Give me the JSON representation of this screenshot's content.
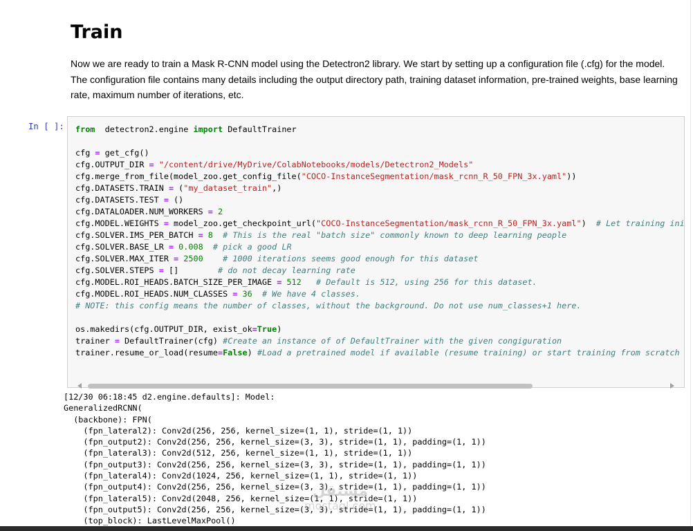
{
  "markdown": {
    "title": "Train",
    "paragraph": "Now we are ready to train a Mask R-CNN model using the Detectron2 library. We start by setting up a configuration file (.cfg) for the model. The configuration file contains many details including the output directory path, training dataset information, pre-trained weights, base learning rate, maximum number of iterations, etc."
  },
  "code_cell": {
    "prompt": "In [ ]:",
    "lines": [
      [
        [
          "kw",
          "from"
        ],
        [
          "",
          "  detectron2.engine "
        ],
        [
          "kw",
          "import"
        ],
        [
          "",
          " DefaultTrainer"
        ]
      ],
      [],
      [
        [
          "",
          "cfg "
        ],
        [
          "op",
          "="
        ],
        [
          "",
          " get_cfg()"
        ]
      ],
      [
        [
          "",
          "cfg.OUTPUT_DIR "
        ],
        [
          "op",
          "="
        ],
        [
          "",
          " "
        ],
        [
          "str",
          "\"/content/drive/MyDrive/ColabNotebooks/models/Detectron2_Models\""
        ]
      ],
      [
        [
          "",
          "cfg.merge_from_file(model_zoo.get_config_file("
        ],
        [
          "str",
          "\"COCO-InstanceSegmentation/mask_rcnn_R_50_FPN_3x.yaml\""
        ],
        [
          "",
          "))"
        ]
      ],
      [
        [
          "",
          "cfg.DATASETS.TRAIN "
        ],
        [
          "op",
          "="
        ],
        [
          "",
          " ("
        ],
        [
          "str",
          "\"my_dataset_train\""
        ],
        [
          "",
          ",)"
        ]
      ],
      [
        [
          "",
          "cfg.DATASETS.TEST "
        ],
        [
          "op",
          "="
        ],
        [
          "",
          " ()"
        ]
      ],
      [
        [
          "",
          "cfg.DATALOADER.NUM_WORKERS "
        ],
        [
          "op",
          "="
        ],
        [
          "",
          " "
        ],
        [
          "num",
          "2"
        ]
      ],
      [
        [
          "",
          "cfg.MODEL.WEIGHTS "
        ],
        [
          "op",
          "="
        ],
        [
          "",
          " model_zoo.get_checkpoint_url("
        ],
        [
          "str",
          "\"COCO-InstanceSegmentation/mask_rcnn_R_50_FPN_3x.yaml\""
        ],
        [
          "",
          ")  "
        ],
        [
          "cm",
          "# Let training initialize from model zoo"
        ]
      ],
      [
        [
          "",
          "cfg.SOLVER.IMS_PER_BATCH "
        ],
        [
          "op",
          "="
        ],
        [
          "",
          " "
        ],
        [
          "num",
          "8"
        ],
        [
          "",
          "  "
        ],
        [
          "cm",
          "# This is the real \"batch size\" commonly known to deep learning people"
        ]
      ],
      [
        [
          "",
          "cfg.SOLVER.BASE_LR "
        ],
        [
          "op",
          "="
        ],
        [
          "",
          " "
        ],
        [
          "num",
          "0.008"
        ],
        [
          "",
          "  "
        ],
        [
          "cm",
          "# pick a good LR"
        ]
      ],
      [
        [
          "",
          "cfg.SOLVER.MAX_ITER "
        ],
        [
          "op",
          "="
        ],
        [
          "",
          " "
        ],
        [
          "num",
          "2500"
        ],
        [
          "",
          "    "
        ],
        [
          "cm",
          "# 1000 iterations seems good enough for this dataset"
        ]
      ],
      [
        [
          "",
          "cfg.SOLVER.STEPS "
        ],
        [
          "op",
          "="
        ],
        [
          "",
          " []        "
        ],
        [
          "cm",
          "# do not decay learning rate"
        ]
      ],
      [
        [
          "",
          "cfg.MODEL.ROI_HEADS.BATCH_SIZE_PER_IMAGE "
        ],
        [
          "op",
          "="
        ],
        [
          "",
          " "
        ],
        [
          "num",
          "512"
        ],
        [
          "",
          "   "
        ],
        [
          "cm",
          "# Default is 512, using 256 for this dataset."
        ]
      ],
      [
        [
          "",
          "cfg.MODEL.ROI_HEADS.NUM_CLASSES "
        ],
        [
          "op",
          "="
        ],
        [
          "",
          " "
        ],
        [
          "num",
          "36"
        ],
        [
          "",
          "  "
        ],
        [
          "cm",
          "# We have 4 classes."
        ]
      ],
      [
        [
          "cm",
          "# NOTE: this config means the number of classes, without the background. Do not use num_classes+1 here."
        ]
      ],
      [],
      [
        [
          "",
          "os.makedirs(cfg.OUTPUT_DIR, exist_ok"
        ],
        [
          "op",
          "="
        ],
        [
          "kw",
          "True"
        ],
        [
          "",
          ")"
        ]
      ],
      [
        [
          "",
          "trainer "
        ],
        [
          "op",
          "="
        ],
        [
          "",
          " DefaultTrainer(cfg) "
        ],
        [
          "cm",
          "#Create an instance of of DefaultTrainer with the given congiguration"
        ]
      ],
      [
        [
          "",
          "trainer.resume_or_load(resume"
        ],
        [
          "op",
          "="
        ],
        [
          "kw",
          "False"
        ],
        [
          "",
          ") "
        ],
        [
          "cm",
          "#Load a pretrained model if available (resume training) or start training from scratch if no pretrained model is available"
        ]
      ]
    ]
  },
  "output_lines": [
    "[12/30 06:18:45 d2.engine.defaults]: Model:",
    "GeneralizedRCNN(",
    "  (backbone): FPN(",
    "    (fpn_lateral2): Conv2d(256, 256, kernel_size=(1, 1), stride=(1, 1))",
    "    (fpn_output2): Conv2d(256, 256, kernel_size=(3, 3), stride=(1, 1), padding=(1, 1))",
    "    (fpn_lateral3): Conv2d(512, 256, kernel_size=(1, 1), stride=(1, 1))",
    "    (fpn_output3): Conv2d(256, 256, kernel_size=(3, 3), stride=(1, 1), padding=(1, 1))",
    "    (fpn_lateral4): Conv2d(1024, 256, kernel_size=(1, 1), stride=(1, 1))",
    "    (fpn_output4): Conv2d(256, 256, kernel_size=(3, 3), stride=(1, 1), padding=(1, 1))",
    "    (fpn_lateral5): Conv2d(2048, 256, kernel_size=(1, 1), stride=(1, 1))",
    "    (fpn_output5): Conv2d(256, 256, kernel_size=(3, 3), stride=(1, 1), padding=(1, 1))",
    "    (top_block): LastLevelMaxPool()"
  ],
  "watermark": {
    "line1": "مستقل",
    "line2": "mostaql.com"
  }
}
